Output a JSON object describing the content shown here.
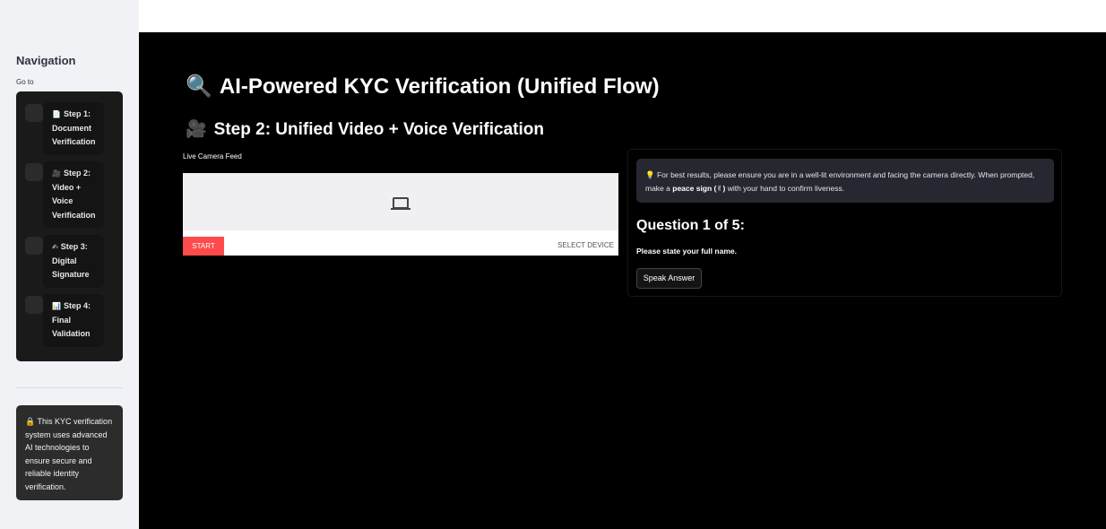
{
  "sidebar": {
    "title": "Navigation",
    "goto_label": "Go to",
    "steps": [
      {
        "icon": "📄",
        "label": "Step 1: Document Verification",
        "lines": [
          "Step 1:",
          "Document",
          "Verification"
        ]
      },
      {
        "icon": "🎥",
        "label": "Step 2: Video + Voice Verification",
        "lines": [
          "Step 2:",
          "Video +",
          "Voice",
          "Verification"
        ]
      },
      {
        "icon": "✍",
        "label": "Step 3: Digital Signature",
        "lines": [
          "Step 3:",
          "Digital",
          "Signature"
        ]
      },
      {
        "icon": "📊",
        "label": "Step 4: Final Validation",
        "lines": [
          "Step 4:",
          "Final",
          "Validation"
        ]
      }
    ],
    "info": "🔒 This KYC verification system uses advanced AI technologies to ensure secure and reliable identity verification."
  },
  "main": {
    "title_icon": "🔍",
    "title": "AI-Powered KYC Verification (Unified Flow)",
    "subtitle_icon": "🎥",
    "subtitle": "Step 2: Unified Video + Voice Verification",
    "camera": {
      "label": "Live Camera Feed",
      "start": "START",
      "select_device": "SELECT DEVICE"
    },
    "panel": {
      "tip_icon": "💡",
      "tip_pre": "For best results, please ensure you are in a well-lit environment and facing the camera directly. When prompted, make a ",
      "tip_bold": "peace sign (✌)",
      "tip_post": " with your hand to confirm liveness.",
      "question_title": "Question 1 of 5:",
      "question_text": "Please state your full name.",
      "speak_button": "Speak Answer"
    }
  }
}
